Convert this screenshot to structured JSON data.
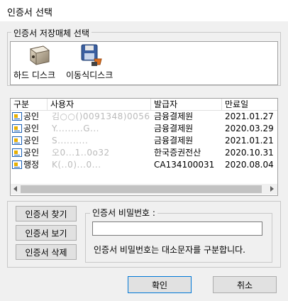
{
  "window": {
    "title": "인증서 선택"
  },
  "storage": {
    "legend": "인증서 저장매체 선택",
    "items": [
      {
        "label": "하드 디스크",
        "icon": "hard-disk-icon"
      },
      {
        "label": "이동식디스크",
        "icon": "removable-disk-icon"
      }
    ]
  },
  "certs": {
    "columns": [
      "구분",
      "사용자",
      "발급자",
      "만료일"
    ],
    "rows": [
      {
        "type": "공인",
        "user": "김○○()0091348)0056...",
        "issuer": "금융결제원",
        "expiry": "2021.01.27"
      },
      {
        "type": "공인",
        "user": "Y.........G...",
        "issuer": "금융결제원",
        "expiry": "2020.03.29"
      },
      {
        "type": "공인",
        "user": "S..........",
        "issuer": "금융결제원",
        "expiry": "2021.01.21"
      },
      {
        "type": "공인",
        "user": "오0...1..0o32",
        "issuer": "한국증권전산",
        "expiry": "2020.10.31"
      },
      {
        "type": "행정",
        "user": "K(..0)...0...",
        "issuer": "CA134100031",
        "expiry": "2020.08.04"
      }
    ]
  },
  "actions": {
    "find": "인증서 찾기",
    "view": "인증서 보기",
    "delete": "인증서 삭제"
  },
  "password": {
    "legend": "인증서 비밀번호 :",
    "value": "",
    "hint": "인증서 비밀번호는 대소문자를 구분합니다."
  },
  "footer": {
    "ok": "확인",
    "cancel": "취소"
  }
}
